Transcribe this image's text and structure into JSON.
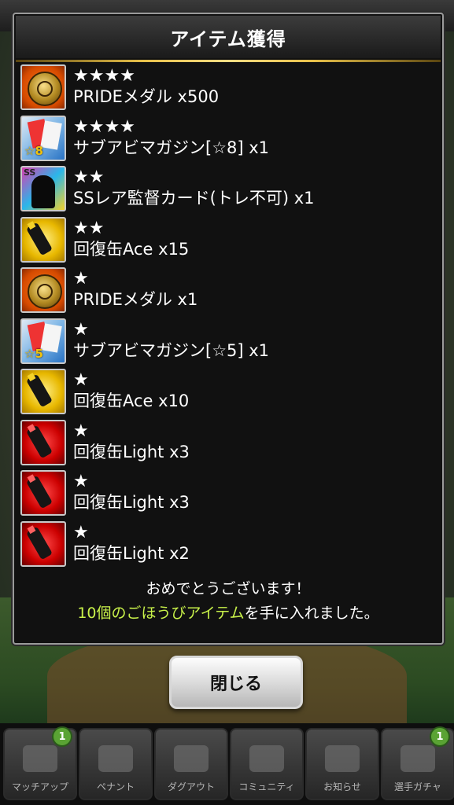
{
  "dialog": {
    "title": "アイテム獲得"
  },
  "items": [
    {
      "stars": "★★★★",
      "name": "PRIDEメダル x500",
      "icon": "medal",
      "badge": ""
    },
    {
      "stars": "★★★★",
      "name": "サブアビマガジン[☆8] x1",
      "icon": "magazine",
      "badge": "☆8"
    },
    {
      "stars": "★★",
      "name": "SSレア監督カード(トレ不可) x1",
      "icon": "manager-card",
      "badge": "SS"
    },
    {
      "stars": "★★",
      "name": "回復缶Ace x15",
      "icon": "ace-can",
      "badge": ""
    },
    {
      "stars": "★",
      "name": "PRIDEメダル x1",
      "icon": "medal",
      "badge": ""
    },
    {
      "stars": "★",
      "name": "サブアビマガジン[☆5] x1",
      "icon": "magazine",
      "badge": "☆5"
    },
    {
      "stars": "★",
      "name": "回復缶Ace x10",
      "icon": "ace-can",
      "badge": ""
    },
    {
      "stars": "★",
      "name": "回復缶Light x3",
      "icon": "light-can",
      "badge": ""
    },
    {
      "stars": "★",
      "name": "回復缶Light x3",
      "icon": "light-can",
      "badge": ""
    },
    {
      "stars": "★",
      "name": "回復缶Light x2",
      "icon": "light-can",
      "badge": ""
    }
  ],
  "message": {
    "line1": "おめでとうございます！",
    "line2_highlight": "10個のごほうびアイテム",
    "line2_rest": "を手に入れました。"
  },
  "close_button": "閉じる",
  "nav": [
    {
      "label": "マッチアップ",
      "badge": "1"
    },
    {
      "label": "ペナント",
      "badge": ""
    },
    {
      "label": "ダグアウト",
      "badge": ""
    },
    {
      "label": "コミュニティ",
      "badge": ""
    },
    {
      "label": "お知らせ",
      "badge": ""
    },
    {
      "label": "選手ガチャ",
      "badge": "1"
    }
  ],
  "colors": {
    "highlight": "#c9f24a",
    "gold": "#e8c14a"
  }
}
